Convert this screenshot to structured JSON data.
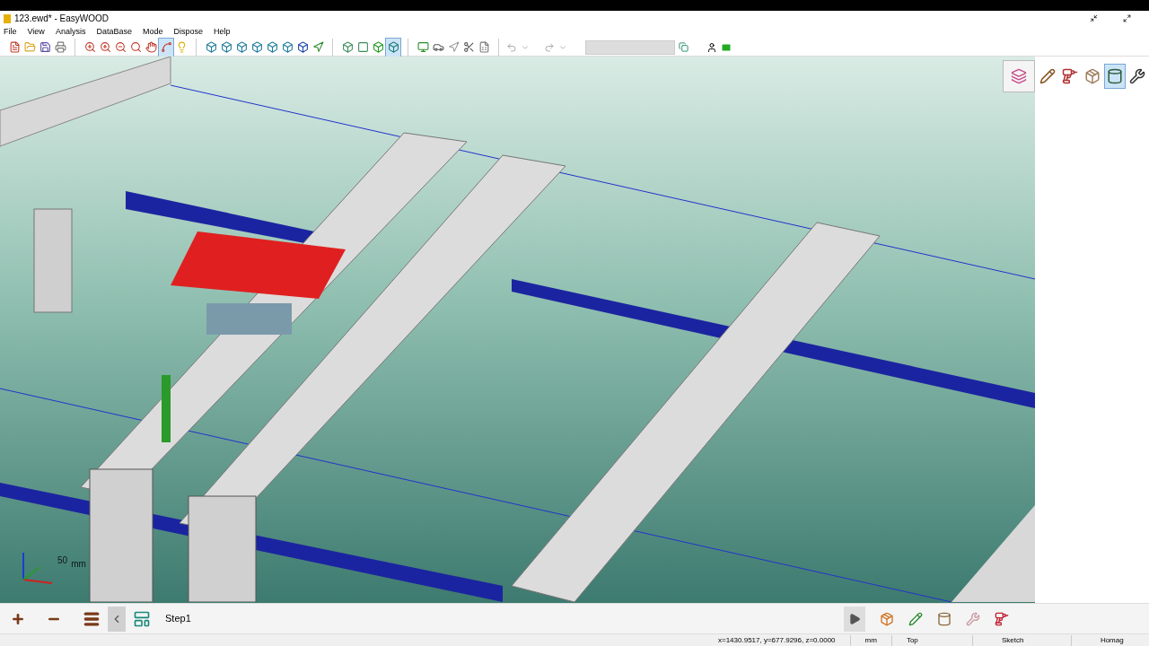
{
  "window": {
    "title": "123.ewd* - EasyWOOD"
  },
  "menu": [
    "File",
    "View",
    "Analysis",
    "DataBase",
    "Mode",
    "Dispose",
    "Help"
  ],
  "toolbar_groups": [
    [
      {
        "selected": false
      },
      {
        "selected": false
      },
      {
        "selected": false
      },
      {
        "selected": false
      }
    ],
    [
      {
        "selected": false
      },
      {
        "selected": false
      },
      {
        "selected": false
      },
      {
        "selected": false
      },
      {
        "selected": false
      },
      {
        "selected": true
      },
      {
        "selected": false
      }
    ],
    [
      {
        "selected": false
      },
      {
        "selected": false
      },
      {
        "selected": false
      },
      {
        "selected": false
      },
      {
        "selected": false
      },
      {
        "selected": false
      },
      {
        "selected": false
      },
      {
        "selected": false
      }
    ],
    [
      {
        "selected": false
      },
      {
        "selected": false
      },
      {
        "selected": false
      },
      {
        "selected": true
      }
    ],
    [
      {
        "selected": false
      },
      {
        "selected": false
      },
      {
        "selected": false
      },
      {
        "selected": false
      },
      {
        "selected": false
      }
    ]
  ],
  "viewport": {
    "scale_value": "50",
    "scale_unit": "mm"
  },
  "side_tools": [
    {
      "selected": false
    },
    {
      "selected": false
    },
    {
      "selected": false
    },
    {
      "selected": true
    },
    {
      "selected": false
    }
  ],
  "step_bar": {
    "step_label": "Step1"
  },
  "status_bar": {
    "coordinates": "x=1430.9517, y=677.9296, z=0.0000",
    "unit": "mm",
    "view": "Top",
    "mode": "Sketch",
    "machine": "Homag"
  }
}
